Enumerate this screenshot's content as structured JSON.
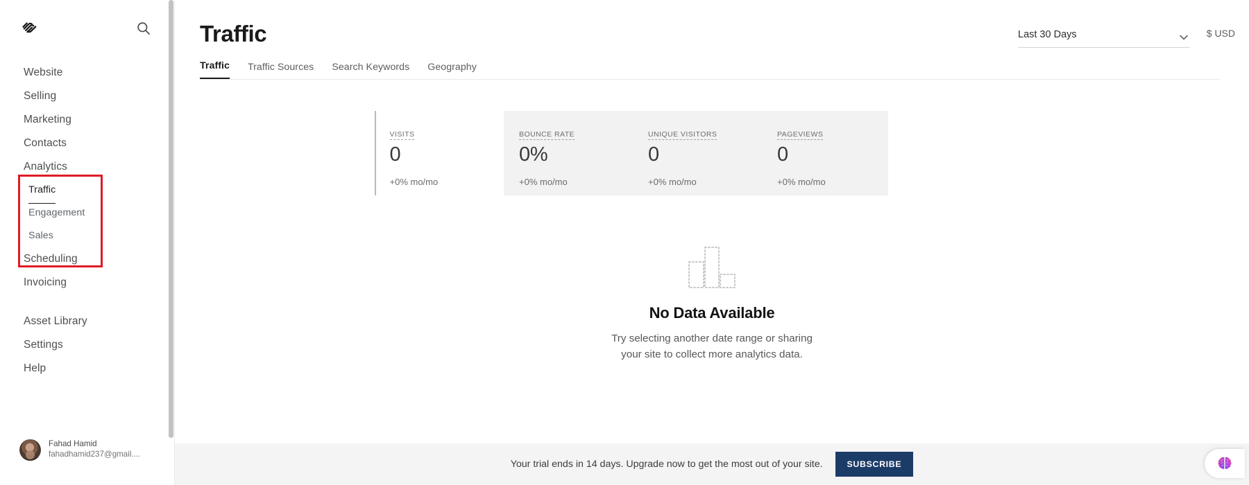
{
  "sidebar": {
    "logo_icon": "squarespace-logo",
    "search_icon": "search-icon",
    "nav": [
      {
        "label": "Website",
        "type": "top"
      },
      {
        "label": "Selling",
        "type": "top"
      },
      {
        "label": "Marketing",
        "type": "top"
      },
      {
        "label": "Contacts",
        "type": "top"
      },
      {
        "label": "Analytics",
        "type": "top"
      },
      {
        "label": "Traffic",
        "type": "sub",
        "active": true
      },
      {
        "label": "Engagement",
        "type": "sub",
        "active": false
      },
      {
        "label": "Sales",
        "type": "sub",
        "active": false
      },
      {
        "label": "Scheduling",
        "type": "top"
      },
      {
        "label": "Invoicing",
        "type": "top"
      },
      {
        "label": "Asset Library",
        "type": "top",
        "gap_before": true
      },
      {
        "label": "Settings",
        "type": "top"
      },
      {
        "label": "Help",
        "type": "top"
      }
    ],
    "user": {
      "name": "Fahad Hamid",
      "email": "fahadhamid237@gmail....",
      "avatar_icon": "avatar"
    }
  },
  "header": {
    "title": "Traffic",
    "date_range": {
      "value": "Last 30 Days",
      "chevron_icon": "chevron-down-icon"
    },
    "currency": "$ USD"
  },
  "tabs": [
    {
      "label": "Traffic",
      "active": true
    },
    {
      "label": "Traffic Sources",
      "active": false
    },
    {
      "label": "Search Keywords",
      "active": false
    },
    {
      "label": "Geography",
      "active": false
    }
  ],
  "metrics": [
    {
      "label": "VISITS",
      "value": "0",
      "delta": "+0% mo/mo",
      "active": true
    },
    {
      "label": "BOUNCE RATE",
      "value": "0%",
      "delta": "+0% mo/mo",
      "active": false
    },
    {
      "label": "UNIQUE VISITORS",
      "value": "0",
      "delta": "+0% mo/mo",
      "active": false
    },
    {
      "label": "PAGEVIEWS",
      "value": "0",
      "delta": "+0% mo/mo",
      "active": false
    }
  ],
  "empty_state": {
    "icon": "bar-chart-dotted-icon",
    "title": "No Data Available",
    "line1": "Try selecting another date range or sharing",
    "line2": "your site to collect more analytics data."
  },
  "banner": {
    "text": "Your trial ends in 14 days. Upgrade now to get the most out of your site.",
    "button": "SUBSCRIBE",
    "button_color": "#1c3c68"
  },
  "assistant": {
    "icon": "brain-icon"
  },
  "annotation": {
    "color": "#e01b24"
  },
  "chart_data": {
    "type": "bar",
    "title": "Traffic",
    "categories": [
      "VISITS",
      "BOUNCE RATE",
      "UNIQUE VISITORS",
      "PAGEVIEWS"
    ],
    "values": [
      0,
      0,
      0,
      0
    ],
    "series": [
      {
        "name": "Visits",
        "values": []
      }
    ],
    "xlabel": "",
    "ylabel": "",
    "ylim": [
      0,
      0
    ],
    "grid": false,
    "legend": "none",
    "annotation": "No Data Available",
    "date_range": "Last 30 Days"
  }
}
